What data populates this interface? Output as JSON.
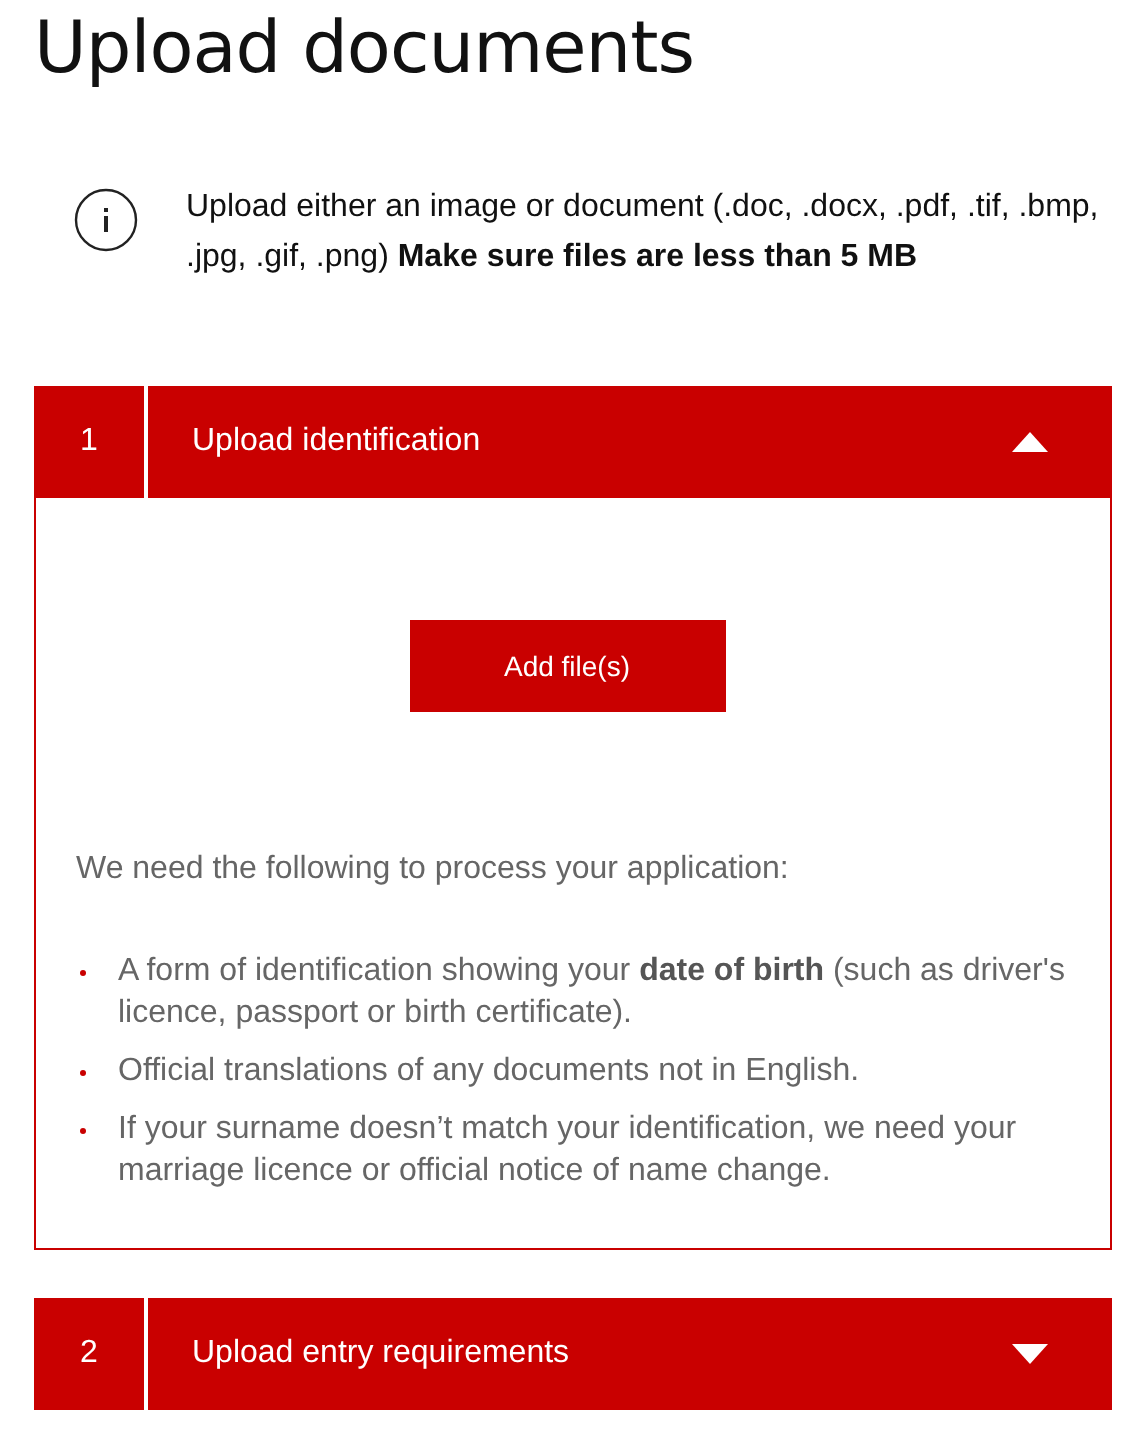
{
  "title": "Upload documents",
  "info": {
    "text": "Upload either an image or document (.doc, .docx, .pdf, .tif, .bmp, .jpg, .gif, .png) **Make sure files are less than 5 MB**"
  },
  "sections": [
    {
      "number": "1",
      "title": "Upload identification",
      "expanded": true,
      "button": "Add file(s)",
      "intro": "We need the following to process your application:",
      "items": [
        "A form of identification showing your **date of birth** (such as driver's licence, passport or birth certificate).",
        "Official translations of any documents not in English.",
        "If your surname doesn’t match your identification, we need your marriage licence or official notice of name change."
      ]
    },
    {
      "number": "2",
      "title": "Upload entry requirements",
      "expanded": false
    }
  ]
}
